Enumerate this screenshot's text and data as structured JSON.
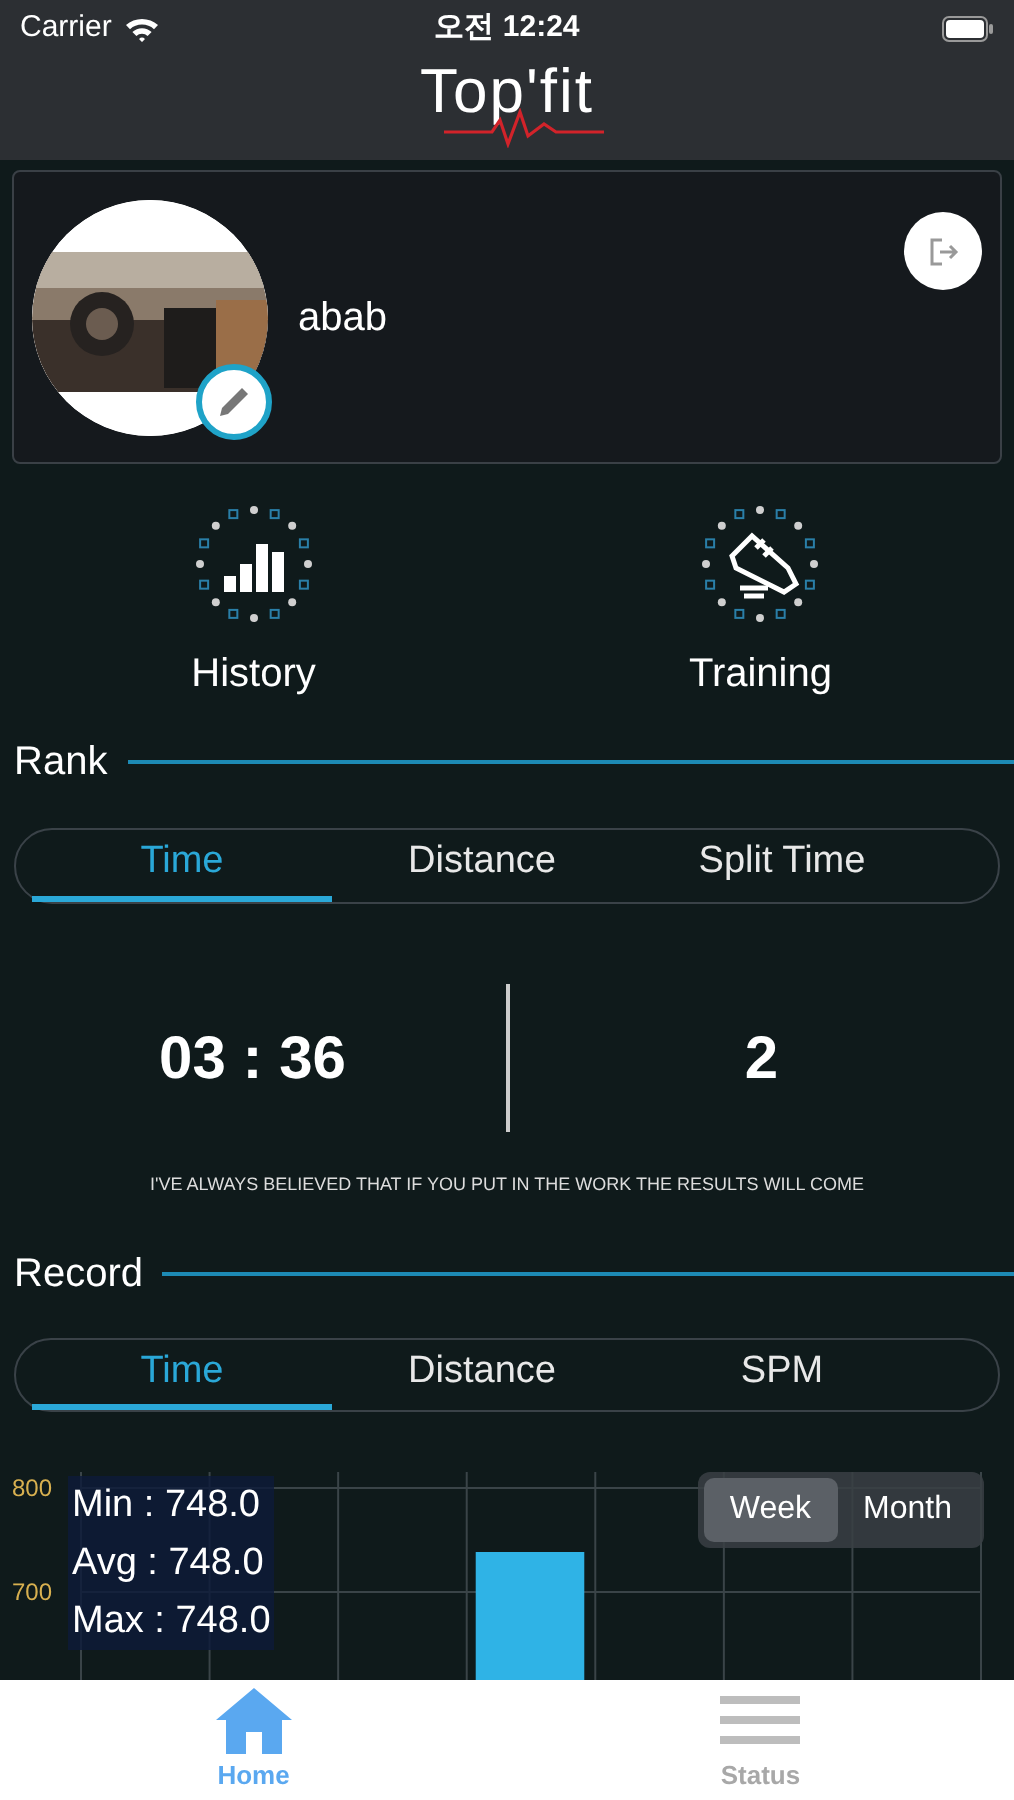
{
  "status_bar": {
    "carrier": "Carrier",
    "time": "오전 12:24"
  },
  "header": {
    "logo": "Top'fit"
  },
  "profile": {
    "name": "abab"
  },
  "shortcuts": [
    {
      "kind": "history",
      "label": "History"
    },
    {
      "kind": "training",
      "label": "Training"
    }
  ],
  "rank": {
    "title": "Rank",
    "tabs": [
      {
        "label": "Time",
        "selected": true
      },
      {
        "label": "Distance",
        "selected": false
      },
      {
        "label": "Split Time",
        "selected": false
      }
    ],
    "time": "03 : 36",
    "rank": "2",
    "quote": "I'VE ALWAYS BELIEVED THAT IF YOU PUT IN THE WORK THE RESULTS WILL COME"
  },
  "record": {
    "title": "Record",
    "tabs": [
      {
        "label": "Time",
        "selected": true
      },
      {
        "label": "Distance",
        "selected": false
      },
      {
        "label": "SPM",
        "selected": false
      }
    ],
    "stats": [
      "Min : 748.0",
      "Avg : 748.0",
      "Max : 748.0"
    ],
    "periods": [
      {
        "label": "Week",
        "selected": true
      },
      {
        "label": "Month",
        "selected": false
      }
    ],
    "y_axis_labels": [
      "800",
      "700"
    ]
  },
  "tab_bar": [
    {
      "kind": "home",
      "label": "Home",
      "selected": true
    },
    {
      "kind": "status",
      "label": "Status",
      "selected": false
    }
  ]
}
